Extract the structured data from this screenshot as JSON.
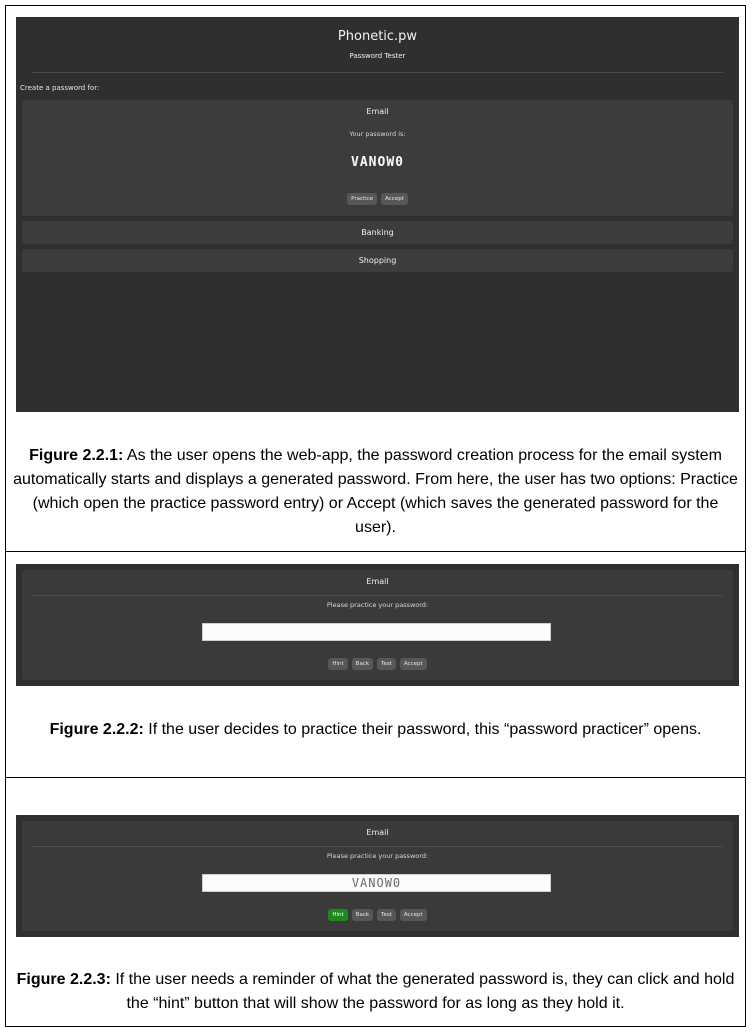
{
  "fig1": {
    "app_title": "Phonetic.pw",
    "app_subtitle": "Password Tester",
    "create_label": "Create a password for:",
    "email_label": "Email",
    "your_password_label": "Your password is:",
    "password": "VANOW0",
    "practice_button": "Practice",
    "accept_button": "Accept",
    "banking_label": "Banking",
    "shopping_label": "Shopping",
    "caption_bold": "Figure 2.2.1:",
    "caption_text": " As the user opens the web-app, the password creation process for the email system automatically starts and displays a generated password. From here, the user has two options: Practice (which open the practice password entry) or Accept (which saves the generated password for the user)."
  },
  "fig2": {
    "title": "Email",
    "prompt": "Please practice your password:",
    "input_value": "",
    "buttons": {
      "hint": "Hint",
      "back": "Back",
      "test": "Test",
      "accept": "Accept"
    },
    "caption_bold": "Figure 2.2.2:",
    "caption_text": " If the user decides to practice their password, this “password practicer” opens."
  },
  "fig3": {
    "title": "Email",
    "prompt": "Please practice your password:",
    "input_value": "VANOW0",
    "buttons": {
      "hint": "Hint",
      "back": "Back",
      "test": "Test",
      "accept": "Accept"
    },
    "hint_color": "#1e8a1e",
    "caption_bold": "Figure 2.2.3:",
    "caption_text": " If the user needs a reminder of what the generated password is, they can click and hold the “hint” button that will show the password for as long as they hold it."
  }
}
